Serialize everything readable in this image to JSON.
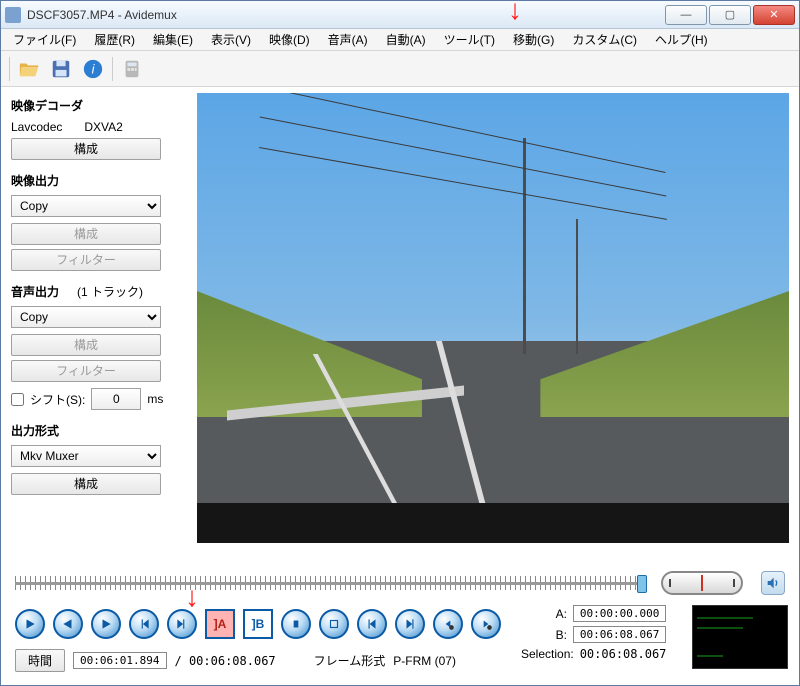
{
  "window": {
    "title": "DSCF3057.MP4 - Avidemux"
  },
  "menu": {
    "file": "ファイル(F)",
    "recent": "履歴(R)",
    "edit": "編集(E)",
    "view": "表示(V)",
    "video": "映像(D)",
    "audio": "音声(A)",
    "auto": "自動(A)",
    "tools": "ツール(T)",
    "go": "移動(G)",
    "custom": "カスタム(C)",
    "help": "ヘルプ(H)"
  },
  "decoder": {
    "heading": "映像デコーダ",
    "name_label": "Lavcodec",
    "hw": "DXVA2",
    "config": "構成"
  },
  "video_out": {
    "heading": "映像出力",
    "codec": "Copy",
    "config": "構成",
    "filter": "フィルター"
  },
  "audio_out": {
    "heading": "音声出力",
    "tracks": "(1 トラック)",
    "codec": "Copy",
    "config": "構成",
    "filter": "フィルター",
    "shift_label": "シフト(S):",
    "shift_value": "0",
    "shift_unit": "ms"
  },
  "output_format": {
    "heading": "出力形式",
    "muxer": "Mkv Muxer",
    "config": "構成"
  },
  "timeline": {
    "position_pct": 99,
    "a": "00:00:00.000",
    "b": "00:06:08.067",
    "selection_label": "Selection:",
    "selection": "00:06:08.067",
    "a_label": "A:",
    "b_label": "B:"
  },
  "time": {
    "btn": "時間",
    "current": "00:06:01.894",
    "total": "/ 00:06:08.067",
    "frame_label": "フレーム形式",
    "frame_value": "P-FRM (07)"
  },
  "icons": {
    "open": "open-icon",
    "save": "save-icon",
    "info": "info-icon",
    "calc": "calc-icon",
    "volume": "volume-icon"
  }
}
